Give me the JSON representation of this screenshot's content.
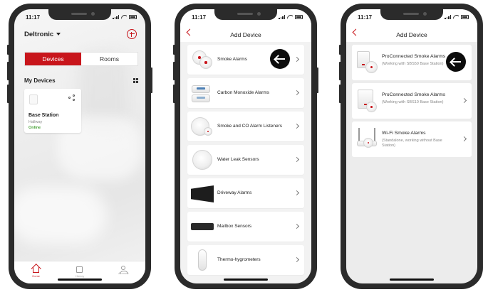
{
  "phone1": {
    "status_time": "11:17",
    "location": "Deltronic",
    "segments": [
      "Devices",
      "Rooms"
    ],
    "my_devices_label": "My Devices",
    "device_card": {
      "name": "Base Station",
      "room": "Hallway",
      "status": "Online"
    },
    "tabs": [
      "Home",
      "History",
      "Account"
    ]
  },
  "phone2": {
    "status_time": "11:17",
    "title": "Add Device",
    "categories": [
      "Smoke Alarms",
      "Carbon Monoxide Alarms",
      "Smoke and CO Alarm Listeners",
      "Water Leak Sensors",
      "Driveway Alarms",
      "Mailbox Sensors",
      "Thermo-hygrometers"
    ]
  },
  "phone3": {
    "status_time": "11:17",
    "title": "Add Device",
    "options": [
      {
        "title": "ProConnected Smoke Alarms",
        "subtitle": "(Working with SBS50 Base Station)"
      },
      {
        "title": "ProConnected Smoke Alarms",
        "subtitle": "(Working with SBS10 Base Station)"
      },
      {
        "title": "Wi-Fi Smoke Alarms",
        "subtitle": "(Standalone, working without Base Station)"
      }
    ]
  },
  "colors": {
    "accent": "#c8151b",
    "online": "#4ca33a",
    "frame": "#2b2b2b"
  },
  "icons": {
    "add": "add-circle-icon",
    "back": "back-chevron-icon",
    "arrow": "left-arrow-icon",
    "grid": "grid-view-icon",
    "share": "share-icon"
  }
}
